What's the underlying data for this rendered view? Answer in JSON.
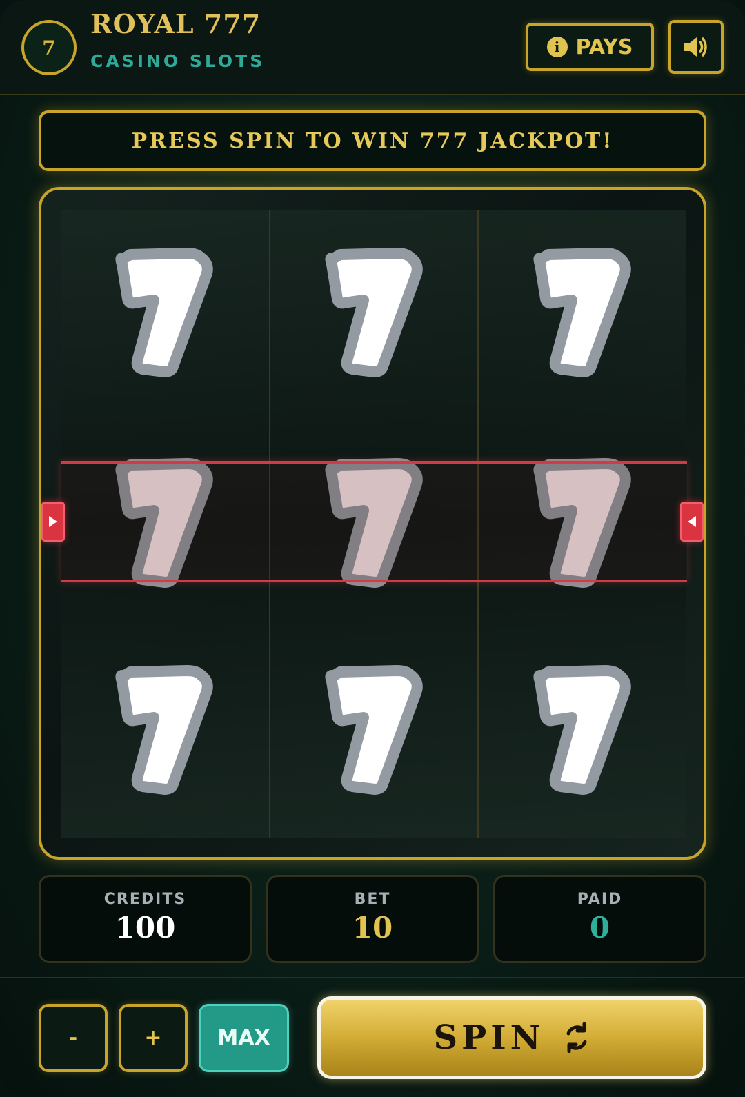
{
  "header": {
    "logo_text": "7",
    "title": "ROYAL 777",
    "subtitle": "CASINO SLOTS",
    "pays_label": "PAYS",
    "info_icon": "i"
  },
  "banner": {
    "message": "PRESS SPIN TO WIN 777 JACKPOT!"
  },
  "reels": [
    {
      "symbols": [
        "7",
        "7",
        "7"
      ]
    },
    {
      "symbols": [
        "7",
        "7",
        "7"
      ]
    },
    {
      "symbols": [
        "7",
        "7",
        "7"
      ]
    }
  ],
  "stats": {
    "credits": {
      "label": "CREDITS",
      "value": "100"
    },
    "bet": {
      "label": "BET",
      "value": "10"
    },
    "paid": {
      "label": "PAID",
      "value": "0"
    }
  },
  "controls": {
    "minus_label": "-",
    "plus_label": "+",
    "max_label": "MAX",
    "spin_label": "SPIN"
  },
  "colors": {
    "gold": "#c8a52a",
    "teal": "#2faa98",
    "payline_red": "#d23a45",
    "bg_dark": "#0a1d17"
  }
}
